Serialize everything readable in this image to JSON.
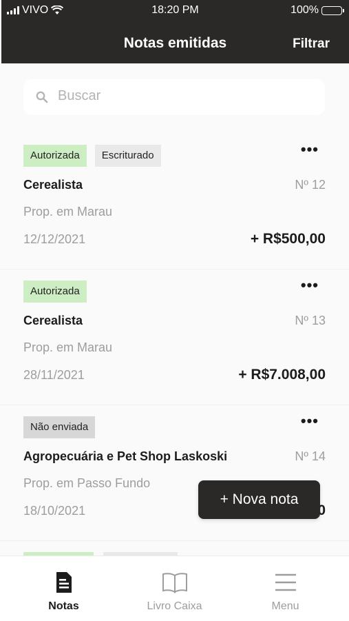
{
  "status_bar": {
    "carrier": "VIVO",
    "time": "18:20 PM",
    "battery": "100%"
  },
  "header": {
    "title": "Notas emitidas",
    "filter_label": "Filtrar"
  },
  "search": {
    "placeholder": "Buscar",
    "value": ""
  },
  "notes": [
    {
      "badges": [
        "Autorizada",
        "Escriturado"
      ],
      "name": "Cerealista",
      "number": "Nº 12",
      "place": "Prop. em Marau",
      "date": "12/12/2021",
      "amount": "+ R$500,00"
    },
    {
      "badges": [
        "Autorizada"
      ],
      "name": "Cerealista",
      "number": "Nº 13",
      "place": "Prop. em Marau",
      "date": "28/11/2021",
      "amount": "+ R$7.008,00"
    },
    {
      "badges": [
        "Não enviada"
      ],
      "name": "Agropecuária e Pet Shop Laskoski",
      "number": "Nº 14",
      "place": "Prop. em Passo Fundo",
      "date": "18/10/2021",
      "amount": "0"
    }
  ],
  "fab": {
    "label": "+ Nova nota"
  },
  "tabs": [
    {
      "label": "Notas",
      "icon": "document-icon",
      "active": true
    },
    {
      "label": "Livro Caixa",
      "icon": "book-icon",
      "active": false
    },
    {
      "label": "Menu",
      "icon": "menu-icon",
      "active": false
    }
  ],
  "colors": {
    "header_bg": "#2b2928",
    "badge_authorized": "#cdedc3",
    "badge_booked": "#e9e9e9",
    "badge_not_sent": "#d7d7d7",
    "muted_text": "#9d9d9d"
  }
}
